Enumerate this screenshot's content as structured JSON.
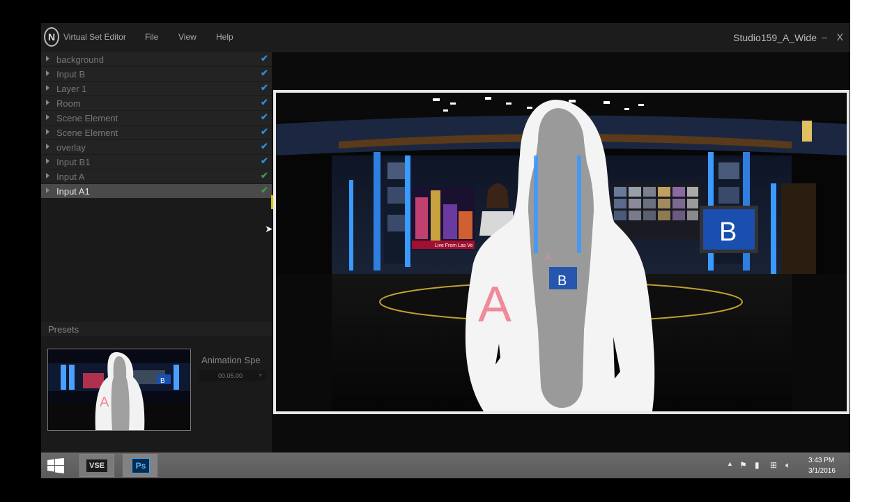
{
  "app": {
    "title": "Virtual Set Editor",
    "document_title": "Studio159_A_Wide",
    "logo_letter": "N",
    "minimize": "–",
    "close": "X"
  },
  "menu": {
    "items": [
      "File",
      "View",
      "Help"
    ]
  },
  "layers": [
    {
      "name": "background",
      "checked": true,
      "color": "#2b8ce0",
      "selected": false
    },
    {
      "name": "Input B",
      "checked": true,
      "color": "#2b8ce0",
      "selected": false
    },
    {
      "name": "Layer 1",
      "checked": true,
      "color": "#2b8ce0",
      "selected": false
    },
    {
      "name": "Room",
      "checked": true,
      "color": "#2b8ce0",
      "selected": false
    },
    {
      "name": "Scene Element",
      "checked": true,
      "color": "#2b8ce0",
      "selected": false
    },
    {
      "name": "Scene Element",
      "checked": true,
      "color": "#2b8ce0",
      "selected": false
    },
    {
      "name": "overlay",
      "checked": true,
      "color": "#2b8ce0",
      "selected": false
    },
    {
      "name": "Input B1",
      "checked": true,
      "color": "#2b8ce0",
      "selected": false
    },
    {
      "name": "Input A",
      "checked": true,
      "color": "#3a9a4a",
      "selected": false
    },
    {
      "name": "Input A1",
      "checked": true,
      "color": "#3a9a4a",
      "selected": true
    }
  ],
  "check_glyph": "✔",
  "presets": {
    "label": "Presets",
    "animation_speed_label": "Animation Spe",
    "animation_speed_value": "00.05.00"
  },
  "preview": {
    "input_a_label": "A",
    "input_b_label": "B",
    "ticker_text": "Live From Las Ve"
  },
  "taskbar": {
    "vse_label": "VSE",
    "ps_label": "Ps",
    "time": "3:43 PM",
    "date": "3/1/2016"
  },
  "colors": {
    "accent_blue": "#2b8ce0",
    "check_green": "#3a9a4a",
    "input_a_pink": "#f08a9a",
    "monitor_blue": "#1a4fb0"
  }
}
